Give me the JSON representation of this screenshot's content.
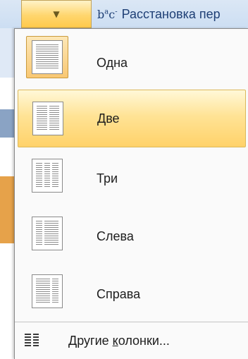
{
  "ribbon": {
    "hyphenation_label": "Расстановка пер",
    "hyphenation_icon": "bc hyphenation icon"
  },
  "menu": {
    "items": [
      {
        "label": "Одна",
        "columns": 1,
        "selected": true
      },
      {
        "label": "Две",
        "columns": 2,
        "hovered": true
      },
      {
        "label": "Три",
        "columns": 3
      },
      {
        "label": "Слева",
        "columns": "left"
      },
      {
        "label": "Справа",
        "columns": "right"
      }
    ],
    "more_columns": {
      "before": "Другие ",
      "mnemonic": "к",
      "after": "олонки..."
    }
  }
}
